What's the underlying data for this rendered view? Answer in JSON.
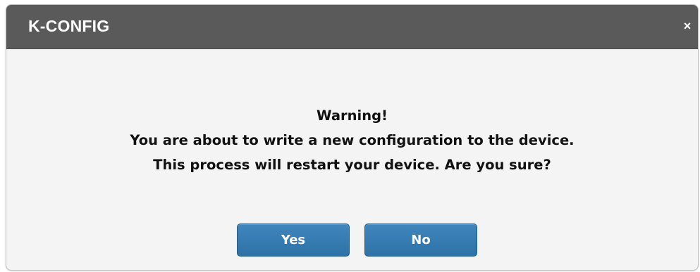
{
  "dialog": {
    "title": "K-CONFIG",
    "close_glyph": "×",
    "message": {
      "heading": "Warning!",
      "line1": "You are about to write a new configuration to the device.",
      "line2": "This process will restart your device. Are you sure?"
    },
    "buttons": {
      "yes_label": "Yes",
      "no_label": "No"
    }
  },
  "colors": {
    "titlebar": "#5a5a5a",
    "body": "#f4f4f4",
    "button": "#3a7fb5",
    "text": "#111111"
  },
  "icons": {
    "close": "close-icon"
  }
}
